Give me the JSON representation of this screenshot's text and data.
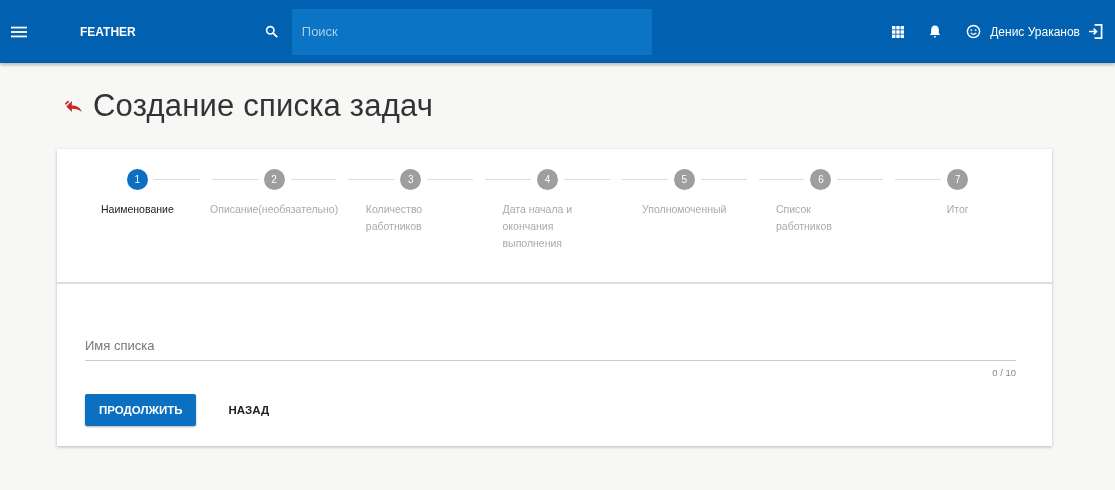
{
  "header": {
    "brand": "FEATHER",
    "search": {
      "placeholder": "Поиск"
    },
    "user": "Денис Ураканов"
  },
  "page": {
    "title": "Создание списка задач"
  },
  "stepper": {
    "steps": [
      {
        "number": "1",
        "label": "Наименование",
        "selected": true
      },
      {
        "number": "2",
        "label": "Описание(необязательно)",
        "selected": false
      },
      {
        "number": "3",
        "label": "Количество работников",
        "selected": false
      },
      {
        "number": "4",
        "label": "Дата начала и окончания выполнения",
        "selected": false
      },
      {
        "number": "5",
        "label": "Уполномоченный",
        "selected": false
      },
      {
        "number": "6",
        "label": "Список работников",
        "selected": false
      },
      {
        "number": "7",
        "label": "Итог",
        "selected": false
      }
    ]
  },
  "form": {
    "field": {
      "placeholder": "Имя списка",
      "counter": "0 / 10"
    },
    "buttons": [
      {
        "label": "ПРОДОЛЖИТЬ",
        "kind": "primary"
      },
      {
        "label": "НАЗАД",
        "kind": "flat"
      }
    ]
  }
}
